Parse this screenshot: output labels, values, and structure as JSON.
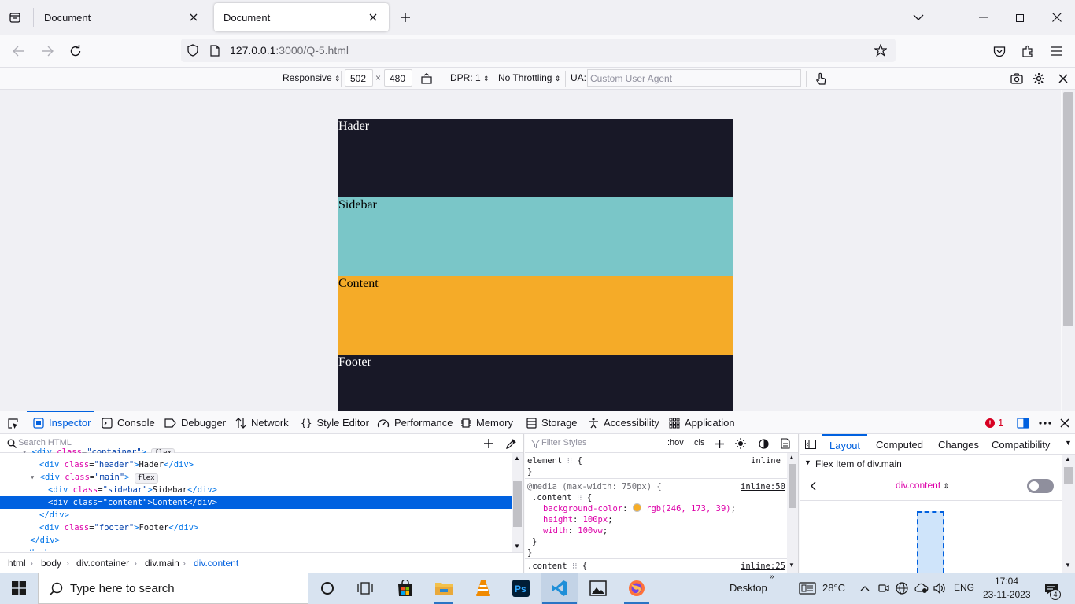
{
  "browser": {
    "tabs": [
      {
        "title": "Document",
        "active": false
      },
      {
        "title": "Document",
        "active": true
      }
    ],
    "url_host": "127.0.0.1",
    "url_path": ":3000/Q-5.html"
  },
  "rdm": {
    "device": "Responsive",
    "width": "502",
    "times": "×",
    "height": "480",
    "dpr": "DPR: 1",
    "throttling": "No Throttling",
    "ua_label": "UA:",
    "ua_placeholder": "Custom User Agent"
  },
  "page": {
    "header": "Hader",
    "sidebar": "Sidebar",
    "content": "Content",
    "footer": "Footer",
    "colors": {
      "header": "#181827",
      "sidebar": "#7ac6c8",
      "content": "#f5ab28",
      "footer": "#181827"
    }
  },
  "devtools": {
    "tabs": [
      "Inspector",
      "Console",
      "Debugger",
      "Network",
      "Style Editor",
      "Performance",
      "Memory",
      "Storage",
      "Accessibility",
      "Application"
    ],
    "error_count": "1",
    "search_placeholder": "Search HTML",
    "markup": {
      "header": "Hader",
      "sidebar": "Sidebar",
      "content": "Content",
      "footer": "Footer",
      "flex_badge": "flex"
    },
    "breadcrumb": [
      "html",
      "body",
      "div.container",
      "div.main",
      "div.content"
    ],
    "rules": {
      "filter_placeholder": "Filter Styles",
      "hov": ":hov",
      "cls": ".cls",
      "element_selector": "element",
      "element_source": "inline",
      "media": "@media (max-width: 750px) {",
      "media_source": "inline:50",
      "content_selector": ".content",
      "decls": [
        {
          "prop": "background-color",
          "value": "rgb(246, 173, 39)"
        },
        {
          "prop": "height",
          "value": "100px"
        },
        {
          "prop": "width",
          "value": "100vw"
        }
      ],
      "second_selector": ".content",
      "second_source": "inline:25"
    },
    "layout": {
      "tabs": [
        "Layout",
        "Computed",
        "Changes",
        "Compatibility"
      ],
      "section": "Flex Item of div.main",
      "item": "div.content"
    }
  },
  "taskbar": {
    "search_placeholder": "Type here to search",
    "desktop": "Desktop",
    "weather": "28°C",
    "lang": "ENG",
    "time": "17:04",
    "date": "23-11-2023",
    "notifications": "4"
  }
}
